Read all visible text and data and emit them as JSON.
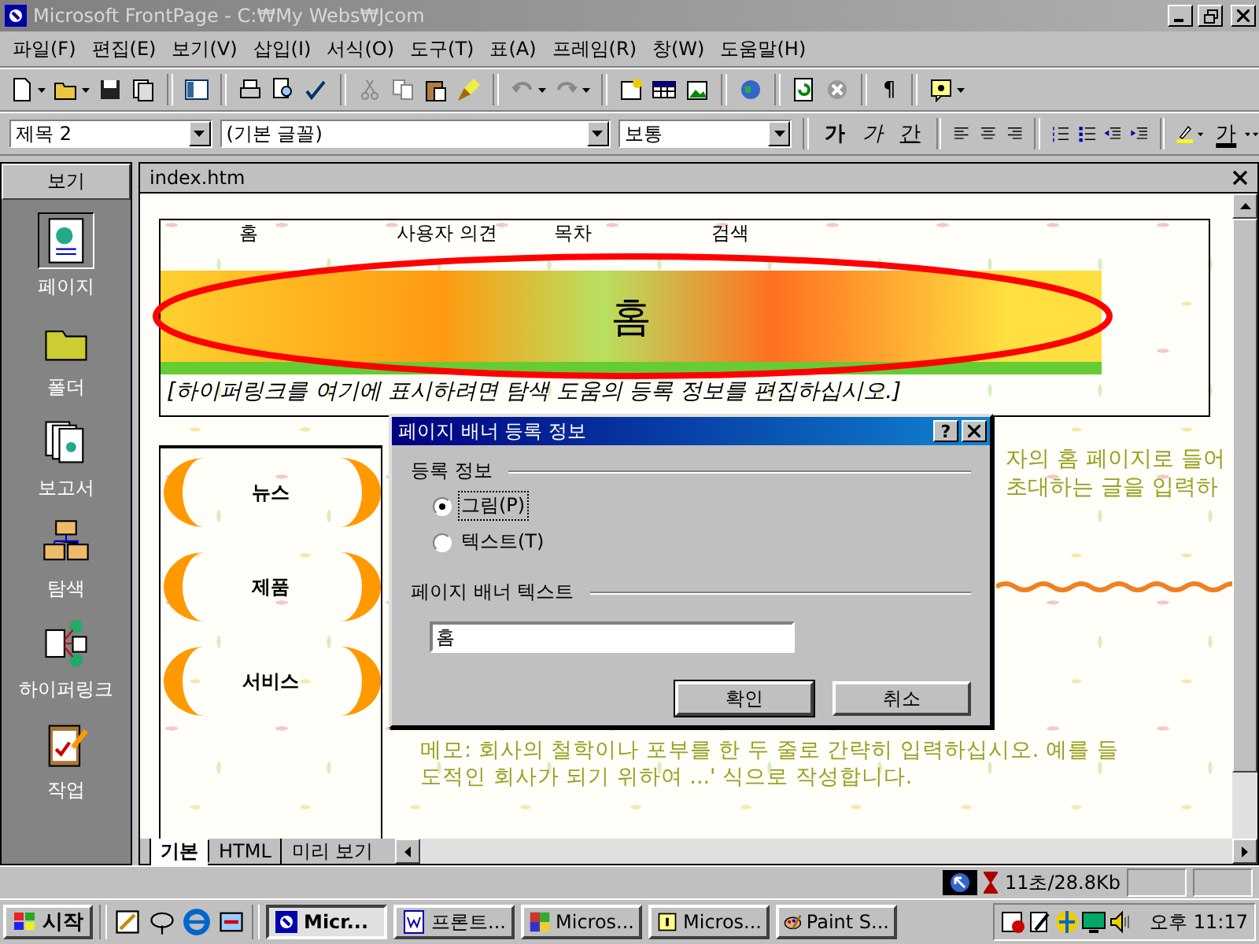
{
  "window": {
    "title": "Microsoft FrontPage - C:₩My Webs₩Jcom"
  },
  "menu": [
    "파일(F)",
    "편집(E)",
    "보기(V)",
    "삽입(I)",
    "서식(O)",
    "도구(T)",
    "표(A)",
    "프레임(R)",
    "창(W)",
    "도움말(H)"
  ],
  "standard_bar": {
    "show_all": "¶"
  },
  "format_bar": {
    "style": "제목 2",
    "font": "(기본 글꼴)",
    "size": "보통",
    "bold": "가",
    "italic": "가",
    "underline": "간",
    "font_color": "가"
  },
  "views_bar": {
    "title": "보기",
    "items": [
      {
        "label": "페이지",
        "kind": "page",
        "selected": true
      },
      {
        "label": "폴더",
        "kind": "folder",
        "selected": false
      },
      {
        "label": "보고서",
        "kind": "reports",
        "selected": false
      },
      {
        "label": "탐색",
        "kind": "navigation",
        "selected": false
      },
      {
        "label": "하이퍼링크",
        "kind": "hyperlinks",
        "selected": false
      },
      {
        "label": "작업",
        "kind": "tasks",
        "selected": false
      }
    ]
  },
  "editor": {
    "tab": "index.htm",
    "nav_links": [
      "홈",
      "사용자 의견",
      "목차",
      "검색"
    ],
    "banner_text": "홈",
    "banner_note": "[하이퍼링크를 여기에 표시하려면 탐색 도움의 등록 정보를 편집하십시오.]",
    "side_buttons": [
      "뉴스",
      "제품",
      "서비스"
    ],
    "body_lines": [
      "자의 홈 페이지로 들어",
      "초대하는 글을 입력하"
    ],
    "memo": [
      "메모: 회사의 철학이나 포부를 한 두 줄로 간략히 입력하십시오. 예를 들",
      "도적인 회사가 되기 위하여 ...' 식으로 작성합니다."
    ],
    "view_tabs": [
      {
        "label": "기본",
        "selected": true
      },
      {
        "label": "HTML",
        "selected": false
      },
      {
        "label": "미리 보기",
        "selected": false
      }
    ]
  },
  "dialog": {
    "title": "페이지 배너 등록 정보",
    "help_button": "?",
    "group_label": "등록 정보",
    "options": [
      {
        "label": "그림(P)",
        "selected": true
      },
      {
        "label": "텍스트(T)",
        "selected": false
      }
    ],
    "text_label": "페이지 배너 텍스트",
    "text_value": "홈",
    "buttons": [
      "확인",
      "취소"
    ]
  },
  "status_bar": {
    "download_time": "11초/28.8Kb"
  },
  "taskbar": {
    "start": "시작",
    "tasks": [
      {
        "label": "Micr...",
        "selected": true
      },
      {
        "label": "프론트...",
        "selected": false
      },
      {
        "label": "Micros...",
        "selected": false
      },
      {
        "label": "Micros...",
        "selected": false
      },
      {
        "label": "Paint S...",
        "selected": false
      }
    ],
    "clock": "오후 11:17"
  }
}
